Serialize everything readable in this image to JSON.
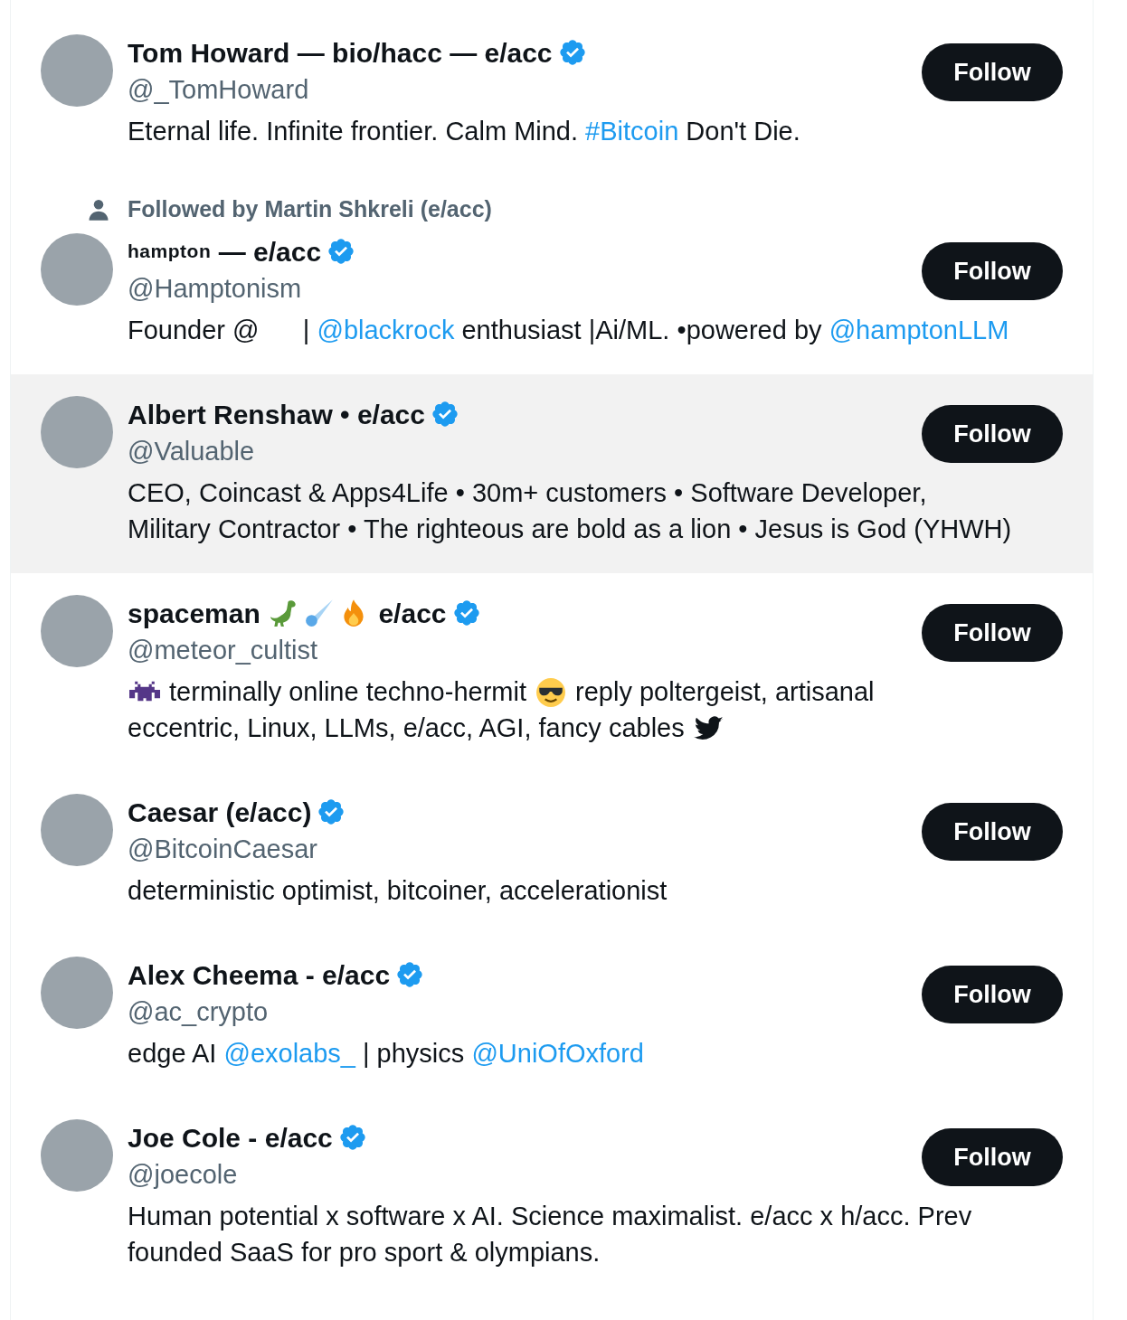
{
  "users": [
    {
      "name": [
        {
          "kind": "text",
          "text": "Tom Howard — bio/hacc — e/acc"
        }
      ],
      "verified": true,
      "handle": "@_TomHoward",
      "highlighted": false,
      "button": "Follow",
      "bio": [
        [
          {
            "kind": "text",
            "text": "Eternal life. Infinite frontier. Calm Mind. "
          },
          {
            "kind": "link",
            "text": "#Bitcoin"
          },
          {
            "kind": "text",
            "text": " Don't Die."
          }
        ]
      ]
    },
    {
      "context": "Followed by Martin Shkreli (e/acc)",
      "name": [
        {
          "kind": "small",
          "text": "hampton"
        },
        {
          "kind": "text",
          "text": " — e/acc"
        }
      ],
      "verified": true,
      "handle": "@Hamptonism",
      "highlighted": false,
      "button": "Follow",
      "bio": [
        [
          {
            "kind": "text",
            "text": "Founder @      | "
          },
          {
            "kind": "link",
            "text": "@blackrock"
          },
          {
            "kind": "text",
            "text": " enthusiast |Ai/ML. •powered by "
          },
          {
            "kind": "link",
            "text": "@hamptonLLM"
          }
        ]
      ]
    },
    {
      "name": [
        {
          "kind": "text",
          "text": "Albert Renshaw • e/acc"
        }
      ],
      "verified": true,
      "handle": "@Valuable",
      "highlighted": true,
      "button": "Follow",
      "bio": [
        [
          {
            "kind": "text",
            "text": "CEO, Coincast & Apps4Life • 30m+ customers • Software Developer,"
          }
        ],
        [
          {
            "kind": "text",
            "text": "Military Contractor • The righteous are bold as a lion • Jesus is God (YHWH)"
          }
        ]
      ]
    },
    {
      "name": [
        {
          "kind": "text",
          "text": "spaceman "
        },
        {
          "kind": "dino"
        },
        {
          "kind": "comet"
        },
        {
          "kind": "fire"
        },
        {
          "kind": "text",
          "text": " e/acc"
        }
      ],
      "verified": true,
      "handle": "@meteor_cultist",
      "highlighted": false,
      "button": "Follow",
      "bio": [
        [
          {
            "kind": "invader"
          },
          {
            "kind": "text",
            "text": " terminally online techno-hermit "
          },
          {
            "kind": "coolface"
          },
          {
            "kind": "text",
            "text": " reply poltergeist, artisanal"
          }
        ],
        [
          {
            "kind": "text",
            "text": "eccentric, Linux, LLMs, e/acc, AGI, fancy cables "
          },
          {
            "kind": "bird"
          }
        ]
      ]
    },
    {
      "name": [
        {
          "kind": "text",
          "text": "Caesar (e/acc)"
        }
      ],
      "verified": true,
      "handle": "@BitcoinCaesar",
      "highlighted": false,
      "button": "Follow",
      "bio": [
        [
          {
            "kind": "text",
            "text": "deterministic optimist, bitcoiner, accelerationist"
          }
        ]
      ]
    },
    {
      "name": [
        {
          "kind": "text",
          "text": "Alex Cheema - e/acc"
        }
      ],
      "verified": true,
      "handle": "@ac_crypto",
      "highlighted": false,
      "button": "Follow",
      "bio": [
        [
          {
            "kind": "text",
            "text": "edge AI "
          },
          {
            "kind": "link",
            "text": "@exolabs_"
          },
          {
            "kind": "text",
            "text": " | physics "
          },
          {
            "kind": "link",
            "text": "@UniOfOxford"
          }
        ]
      ]
    },
    {
      "name": [
        {
          "kind": "text",
          "text": "Joe Cole - e/acc"
        }
      ],
      "verified": true,
      "handle": "@joecole",
      "highlighted": false,
      "button": "Follow",
      "bio": [
        [
          {
            "kind": "text",
            "text": "Human potential x software x AI. Science maximalist. e/acc x h/acc. Prev"
          }
        ],
        [
          {
            "kind": "text",
            "text": "founded SaaS for pro sport & olympians."
          }
        ]
      ]
    }
  ]
}
